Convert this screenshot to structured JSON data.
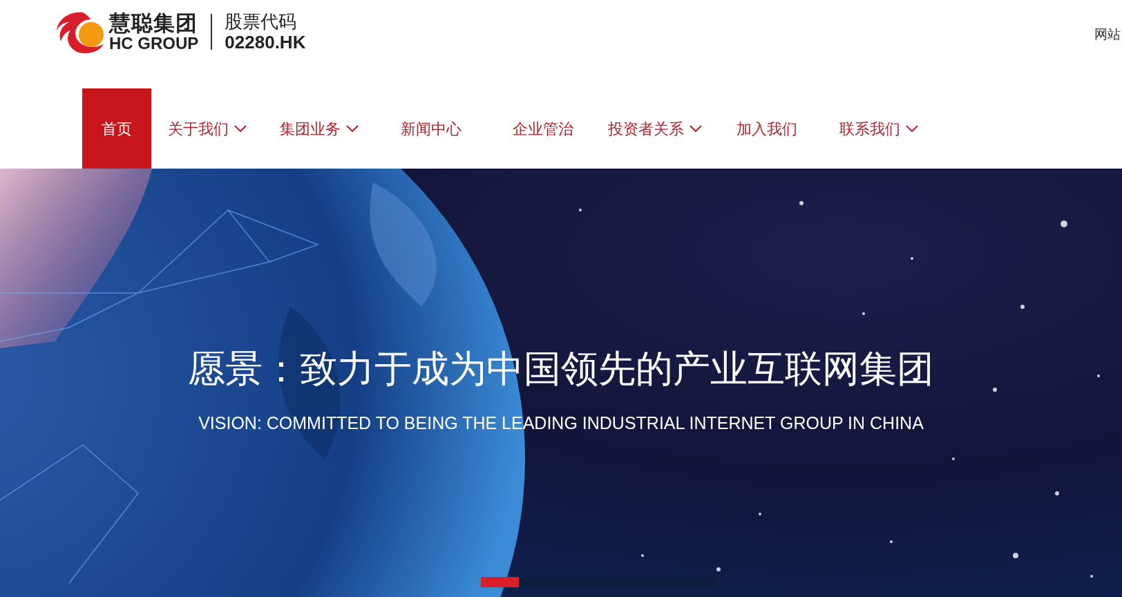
{
  "header": {
    "logo": {
      "name_cn": "慧聪集团",
      "name_en": "HC GROUP"
    },
    "stock": {
      "label": "股票代码",
      "code": "02280.HK"
    },
    "top_link": "网站"
  },
  "nav": [
    {
      "label": "首页",
      "selected": true,
      "dropdown": false
    },
    {
      "label": "关于我们",
      "selected": false,
      "dropdown": true
    },
    {
      "label": "集团业务",
      "selected": false,
      "dropdown": true
    },
    {
      "label": "新闻中心",
      "selected": false,
      "dropdown": false
    },
    {
      "label": "企业管治",
      "selected": false,
      "dropdown": false
    },
    {
      "label": "投资者关系",
      "selected": false,
      "dropdown": true
    },
    {
      "label": "加入我们",
      "selected": false,
      "dropdown": false
    },
    {
      "label": "联系我们",
      "selected": false,
      "dropdown": true
    }
  ],
  "banner": {
    "headline": "愿景：致力于成为中国领先的产业互联网集团",
    "subline": "VISION: COMMITTED TO BEING THE LEADING INDUSTRIAL INTERNET GROUP IN CHINA",
    "slides": [
      {
        "selected": true
      },
      {
        "selected": false
      },
      {
        "selected": false
      },
      {
        "selected": false
      },
      {
        "selected": false
      },
      {
        "selected": false
      }
    ]
  }
}
